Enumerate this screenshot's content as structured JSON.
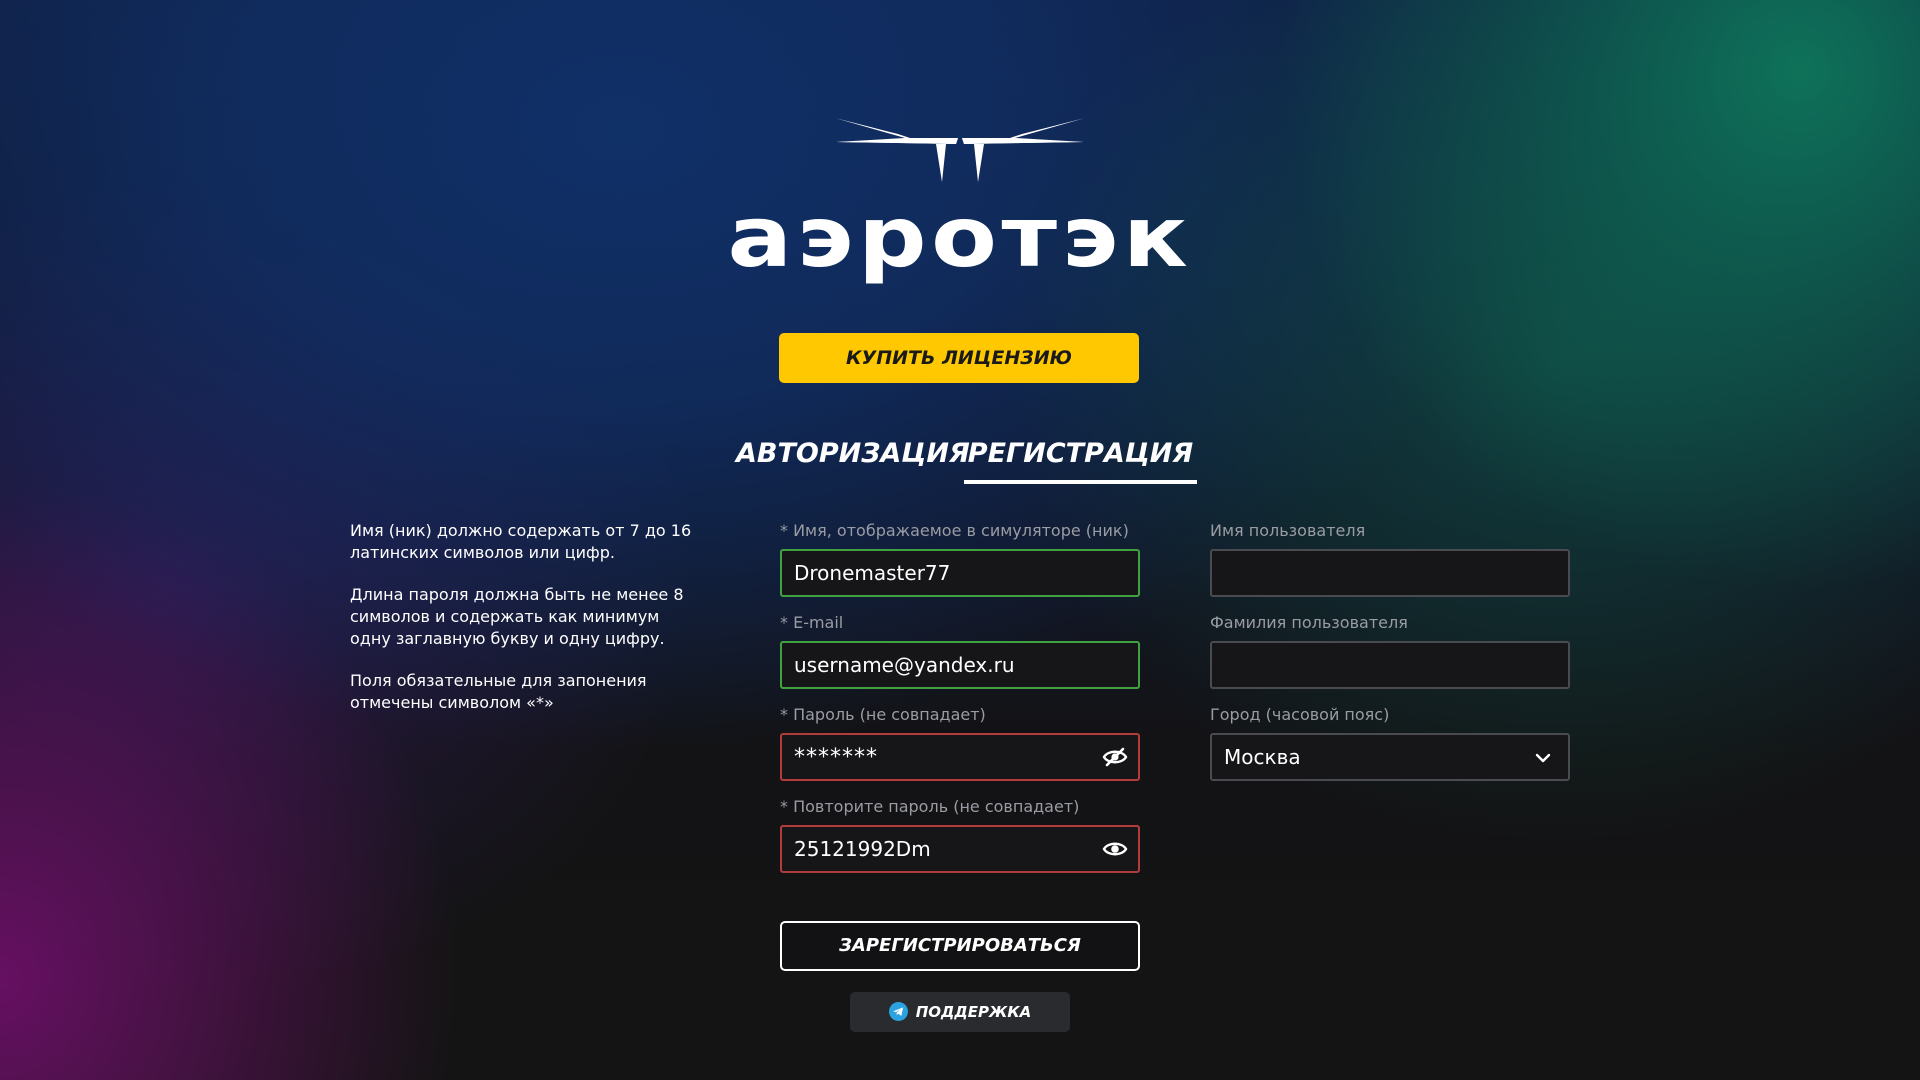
{
  "logo": {
    "wordmark": "аэротэк"
  },
  "buy_button": {
    "label": "КУПИТЬ ЛИЦЕНЗИЮ"
  },
  "tabs": [
    {
      "label": "АВТОРИЗАЦИЯ",
      "active": false
    },
    {
      "label": "РЕГИСТРАЦИЯ",
      "active": true
    }
  ],
  "hints": [
    "Имя (ник) должно содержать от 7 до 16 латинских символов или цифр.",
    "Длина пароля должна быть не менее 8 символов и содержать как минимум одну заглавную букву и одну цифру.",
    "Поля обязательные для запонения отмечены символом «*»"
  ],
  "form": {
    "nick": {
      "label": "* Имя, отображаемое в симуляторе (ник)",
      "value": "Dronemaster77",
      "state": "valid"
    },
    "email": {
      "label": "* E-mail",
      "value": "username@yandex.ru",
      "state": "valid"
    },
    "password": {
      "label": "* Пароль (не совпадает)",
      "value": "*******",
      "state": "error",
      "icon": "eye-off-icon"
    },
    "password_repeat": {
      "label": "* Повторите пароль (не совпадает)",
      "value": "25121992Dm",
      "state": "error",
      "icon": "eye-icon"
    },
    "first_name": {
      "label": "Имя пользователя",
      "value": ""
    },
    "last_name": {
      "label": "Фамилия пользователя",
      "value": ""
    },
    "city": {
      "label": "Город (часовой пояс)",
      "value": "Москва",
      "icon": "chevron-down-icon"
    }
  },
  "register_button": {
    "label": "ЗАРЕГИСТРИРОВАТЬСЯ"
  },
  "support_button": {
    "label": "ПОДДЕРЖКА",
    "icon": "telegram-icon"
  },
  "colors": {
    "accent_yellow": "#ffc800",
    "valid_border": "#3fa13f",
    "error_border": "#b23b3b",
    "field_border": "#4a4b50",
    "label_gray": "#9a9ca3"
  }
}
